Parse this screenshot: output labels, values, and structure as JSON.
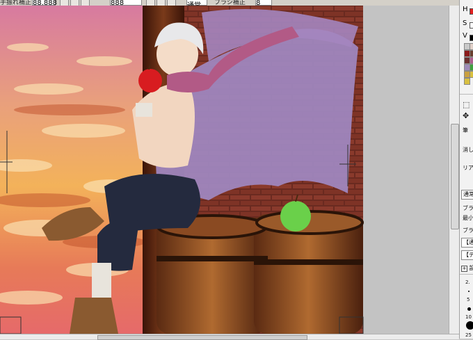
{
  "toolbar": {
    "item1": "手振れ補正",
    "field1": "88.888",
    "field2": "888",
    "mode": "通常",
    "correction": "ブラシ補正",
    "correction_val": "8"
  },
  "panel": {
    "h_label": "H",
    "s_label": "S",
    "v_label": "V",
    "tool_pen": "筆",
    "tool_eraser": "消し",
    "tool_real": "リアル",
    "blend": "通常",
    "brush1": "ブラ",
    "min": "最小",
    "brush2": "ブラ",
    "opt1": "【通",
    "opt2": "【テ",
    "section": "設",
    "size_label": "2.",
    "size2": "5",
    "size3": "10",
    "size4": "25"
  },
  "colors": {
    "swatches": [
      "#c9c9c9",
      "#8a1a1a",
      "#e0d0c8",
      "#6a4030",
      "#b06090",
      "#9d8ab8",
      "#c9a040",
      "#40a040",
      "#d9c040"
    ]
  }
}
